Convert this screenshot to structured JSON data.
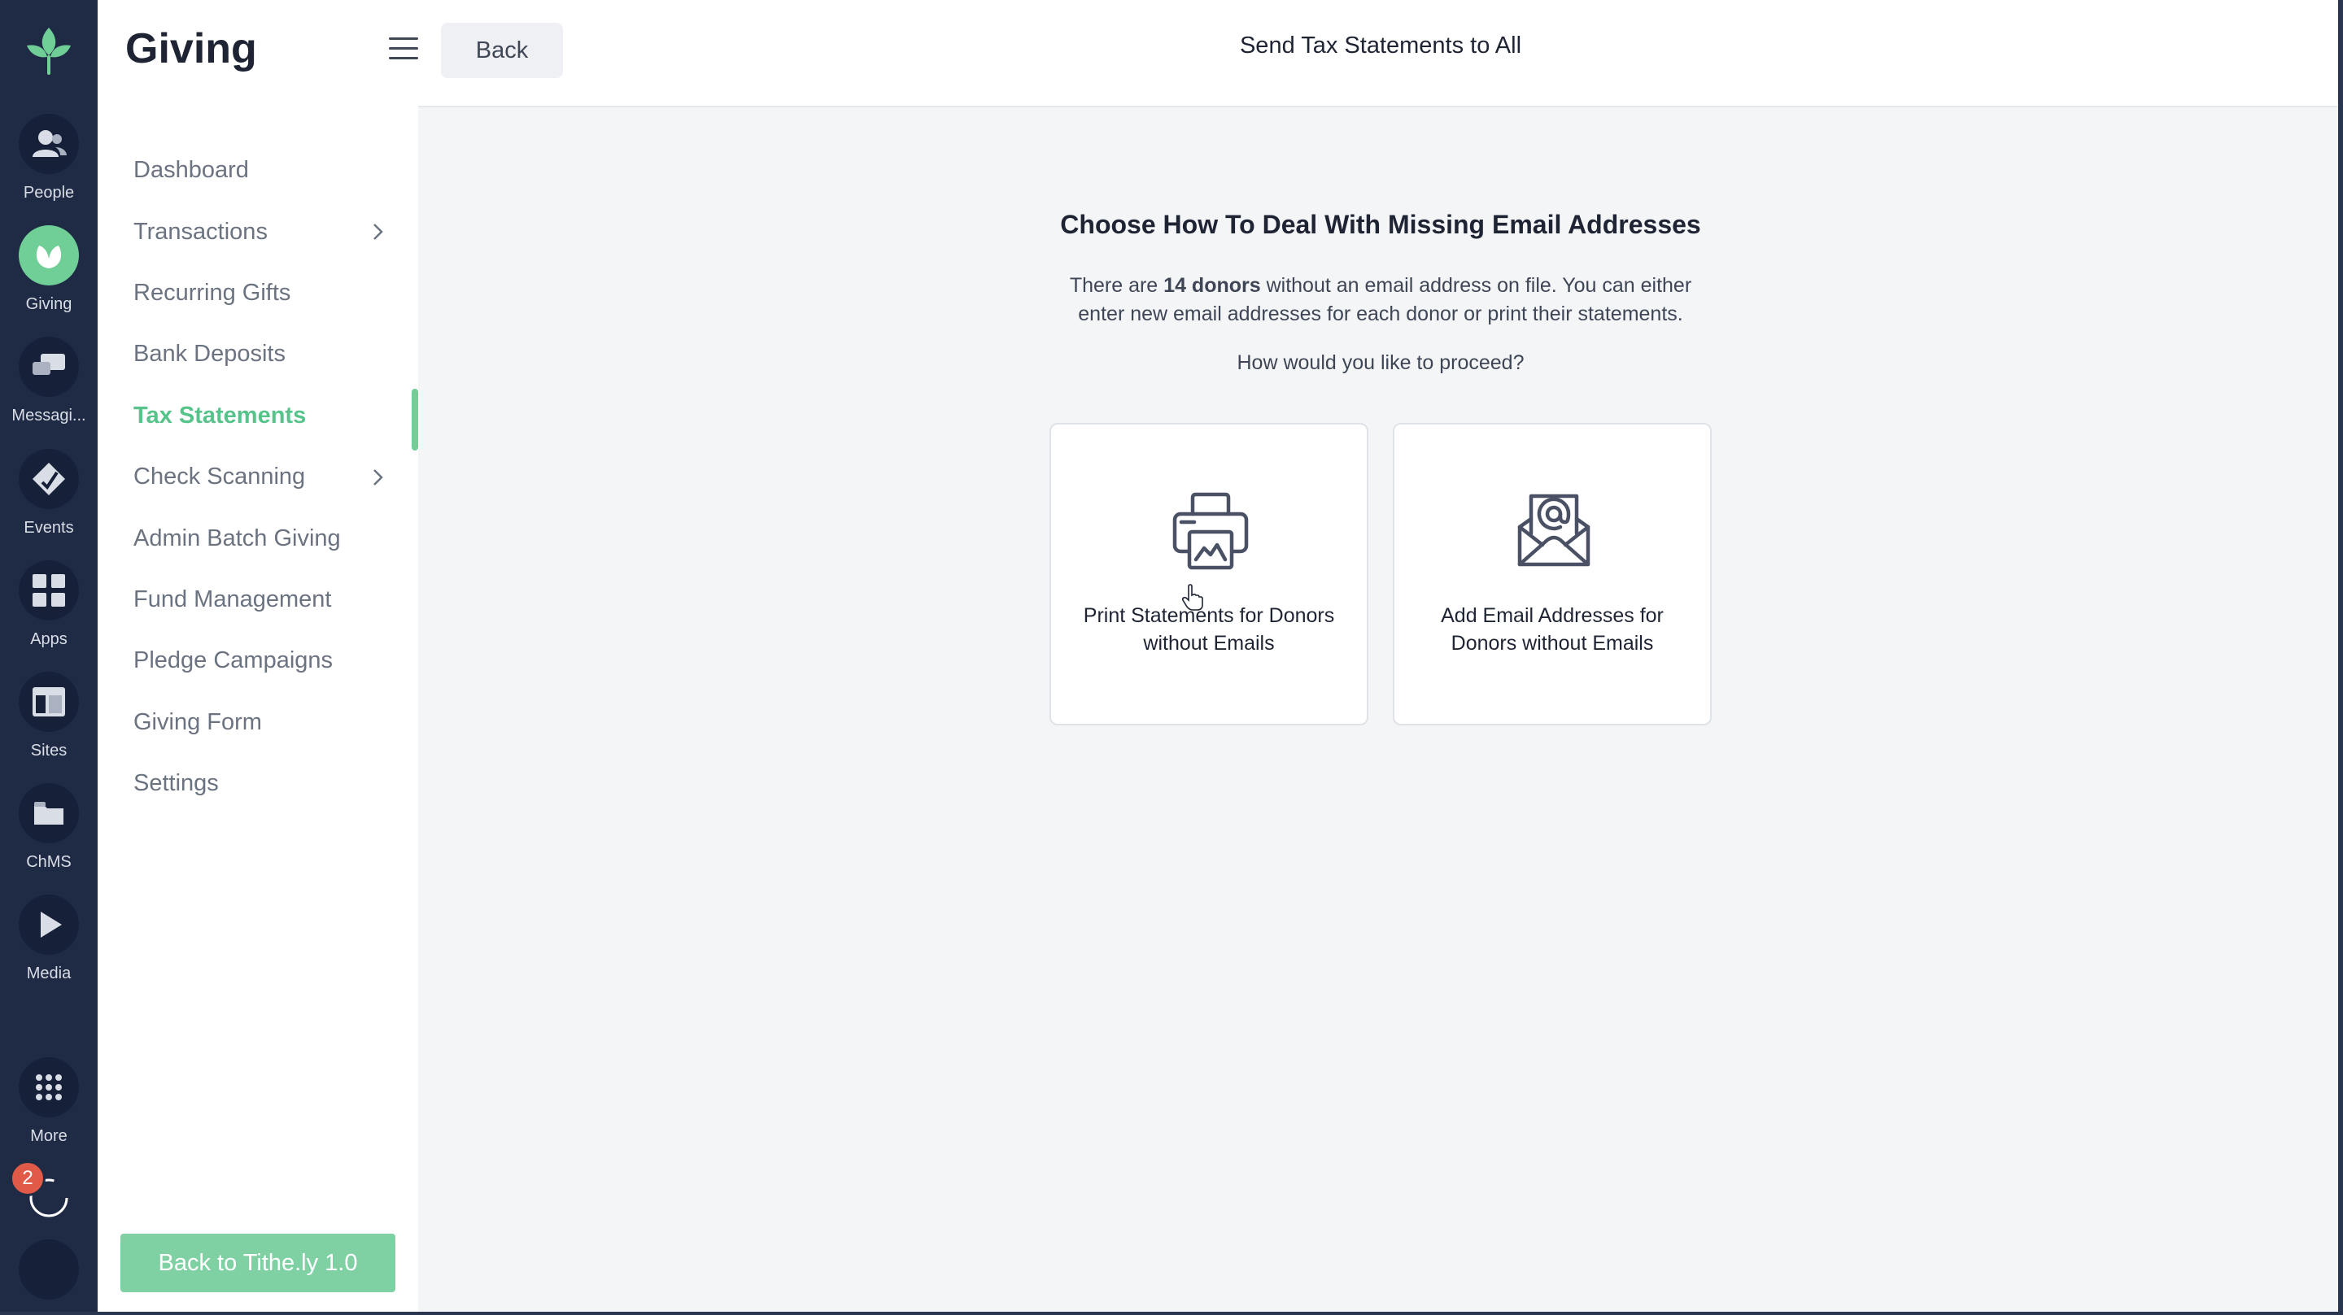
{
  "rail": {
    "items": [
      {
        "label": "People",
        "icon": "people-icon"
      },
      {
        "label": "Giving",
        "icon": "giving-leaf-icon"
      },
      {
        "label": "Messagi...",
        "icon": "messaging-icon"
      },
      {
        "label": "Events",
        "icon": "events-icon"
      },
      {
        "label": "Apps",
        "icon": "apps-icon"
      },
      {
        "label": "Sites",
        "icon": "sites-icon"
      },
      {
        "label": "ChMS",
        "icon": "folder-icon"
      },
      {
        "label": "Media",
        "icon": "play-icon"
      },
      {
        "label": "More",
        "icon": "grid-dots-icon"
      }
    ],
    "notification_count": "2"
  },
  "sidebar": {
    "title": "Giving",
    "items": [
      {
        "label": "Dashboard"
      },
      {
        "label": "Transactions"
      },
      {
        "label": "Recurring Gifts"
      },
      {
        "label": "Bank Deposits"
      },
      {
        "label": "Tax Statements"
      },
      {
        "label": "Check Scanning"
      },
      {
        "label": "Admin Batch Giving"
      },
      {
        "label": "Fund Management"
      },
      {
        "label": "Pledge Campaigns"
      },
      {
        "label": "Giving Form"
      },
      {
        "label": "Settings"
      }
    ],
    "active_item": "Tax Statements",
    "footer_button": "Back to Tithe.ly 1.0"
  },
  "header": {
    "back_label": "Back",
    "title": "Send Tax Statements to All"
  },
  "main": {
    "heading": "Choose How To Deal With Missing Email Addresses",
    "desc_pre": "There are ",
    "desc_bold": "14 donors",
    "desc_post": " without an email address on file. You can either enter new email addresses for each donor or print their statements.",
    "question": "How would you like to proceed?",
    "options": [
      {
        "label": "Print Statements for Donors without Emails",
        "icon": "printer-icon"
      },
      {
        "label": "Add Email Addresses for Donors without Emails",
        "icon": "email-envelope-icon"
      }
    ]
  },
  "colors": {
    "rail_bg": "#1f2a44",
    "accent_green": "#6fcf97",
    "badge_red": "#e05a47"
  }
}
